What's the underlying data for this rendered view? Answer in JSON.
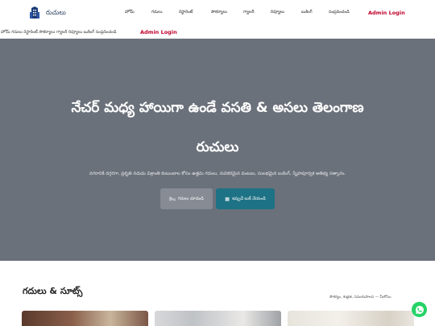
{
  "brand": {
    "name": "రుచులు",
    "icon": "building-icon"
  },
  "nav": {
    "links": [
      "హోమ్",
      "గదులు",
      "రెస్టారెంట్",
      "సౌకర్యాలు",
      "గ్యాలరీ",
      "రివ్యూలు",
      "బుకింగ్",
      "సంప్రదించండి"
    ],
    "admin": "Admin Login"
  },
  "subnav": {
    "text": "హోమ్ గదులు రెస్టారెంట్ సౌకర్యాలు గ్యాలరీ రివ్యూలు బుకింగ్ సంప్రదించండి",
    "admin": "Admin Login"
  },
  "hero": {
    "title_line1": "నేచర్ మధ్య హాయిగా ఉండే వసతి & అసలు తెలంగాణ",
    "title_line2": "రుచులు",
    "subtitle": "నగరానికి దగ్గరగా, ప్రకృతి నడుమ విశ్రాంతి కుటుంబాల కోసం ఉత్తమ గదులు, రుచికరమైన వంటలు, సులభమైన బుకింగ్, స్నేహపూర్వక ఆతిథ్య సత్కారం.",
    "btn_rooms": "గదులు చూడండి",
    "btn_book": "ఇప్పుడే బుక్ చేయండి",
    "btn_rooms_icon": "bed-icon",
    "btn_book_icon": "calendar-icon"
  },
  "section": {
    "title": "గదులు & సూట్స్",
    "note": "సౌకర్యం, శుభ్రత, సమయపాలన — మీకోసం."
  },
  "colors": {
    "hero_bg": "#6b717b",
    "accent": "#1e7285",
    "admin": "#c0002a",
    "whatsapp": "#25d366"
  },
  "whatsapp_icon": "whatsapp-icon"
}
